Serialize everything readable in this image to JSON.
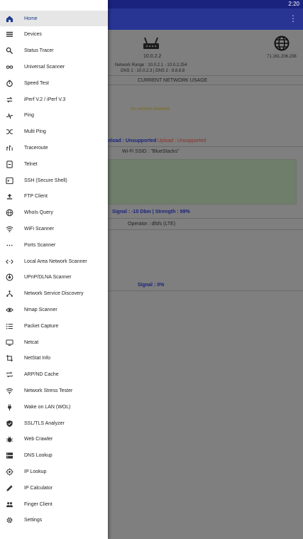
{
  "status_bar": {
    "time": "2:20"
  },
  "app_bar": {
    "overflow_icon": "more-vert-icon"
  },
  "background": {
    "router_ip": "10.0.2.2",
    "network_range": "Network Range : 10.0.2.1 - 10.0.2.254",
    "dns_line": "DNS 1 : 10.0.2.3 | DNS 2 : 8.8.8.8",
    "public_ip": "71.161.206.238",
    "usage_title": "CURRENT NETWORK USAGE",
    "usage_note": "No network detected",
    "download_text": "nload : Unsupported",
    "upload_text": "Upload : Unsupported",
    "wifi_ssid": "Wi-Fi SSID : \"BlueStacks\"",
    "wifi_signal": "Signal : -10 Dbm  |  Strength : 99%",
    "operator": "Operator : dfsfs (LTE)",
    "mobile_signal": "Signal : 0%"
  },
  "drawer": {
    "items": [
      {
        "label": "Home",
        "icon": "home-icon"
      },
      {
        "label": "Devices",
        "icon": "devices-list-icon"
      },
      {
        "label": "Status Tracer",
        "icon": "search-icon"
      },
      {
        "label": "Universal Scanner",
        "icon": "infinity-icon"
      },
      {
        "label": "Speed Test",
        "icon": "stopwatch-icon"
      },
      {
        "label": "iPerf V.2 / iPerf V.3",
        "icon": "swap-icon"
      },
      {
        "label": "Ping",
        "icon": "ping-icon"
      },
      {
        "label": "Multi Ping",
        "icon": "shuffle-icon"
      },
      {
        "label": "Traceroute",
        "icon": "traceroute-icon"
      },
      {
        "label": "Telnet",
        "icon": "telnet-icon"
      },
      {
        "label": "SSH (Secure Shell)",
        "icon": "terminal-icon"
      },
      {
        "label": "FTP Client",
        "icon": "upload-icon"
      },
      {
        "label": "WhoIs Query",
        "icon": "globe-icon"
      },
      {
        "label": "WiFi Scanner",
        "icon": "wifi-icon"
      },
      {
        "label": "Ports Scanner",
        "icon": "dots-icon"
      },
      {
        "label": "Local Area Network Scanner",
        "icon": "code-arrows-icon"
      },
      {
        "label": "UPnP/DLNA Scanner",
        "icon": "upnp-icon"
      },
      {
        "label": "Network Service Discovery",
        "icon": "network-tree-icon"
      },
      {
        "label": "Nmap Scanner",
        "icon": "eye-icon"
      },
      {
        "label": "Packet Capture",
        "icon": "list-icon"
      },
      {
        "label": "Netcat",
        "icon": "monitor-icon"
      },
      {
        "label": "NetStat Info",
        "icon": "crop-icon"
      },
      {
        "label": "ARP/ND Cache",
        "icon": "repeat-icon"
      },
      {
        "label": "Network Stress Tester",
        "icon": "wifi-stress-icon"
      },
      {
        "label": "Wake on LAN (WOL)",
        "icon": "power-plug-icon"
      },
      {
        "label": "SSL/TLS Analyzer",
        "icon": "shield-icon"
      },
      {
        "label": "Web Crawler",
        "icon": "bug-icon"
      },
      {
        "label": "DNS Lookup",
        "icon": "dns-icon"
      },
      {
        "label": "IP Lookup",
        "icon": "target-icon"
      },
      {
        "label": "IP Calculator",
        "icon": "pencil-icon"
      },
      {
        "label": "Finger Client",
        "icon": "people-icon"
      },
      {
        "label": "Settings",
        "icon": "gear-icon"
      }
    ]
  }
}
